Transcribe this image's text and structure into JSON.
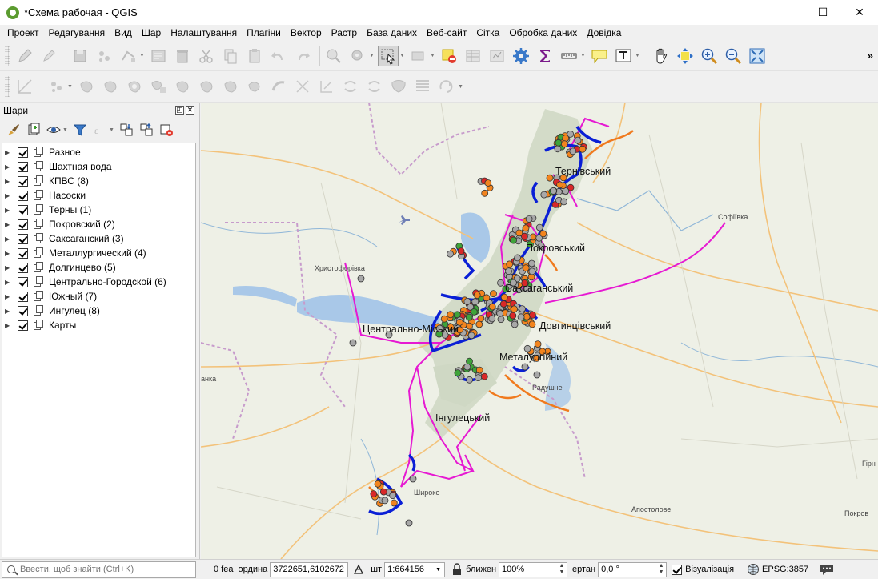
{
  "window": {
    "title": "*Схема рабочая - QGIS",
    "minimize_glyph": "—",
    "maximize_glyph": "☐",
    "close_glyph": "✕"
  },
  "menu": [
    "Проект",
    "Редагування",
    "Вид",
    "Шар",
    "Налаштування",
    "Плагіни",
    "Вектор",
    "Растр",
    "База даних",
    "Веб-сайт",
    "Сітка",
    "Обробка даних",
    "Довідка"
  ],
  "toolbar": {
    "more_glyph": "»"
  },
  "layers_panel": {
    "title": "Шари",
    "layers": [
      "Разное",
      "Шахтная вода",
      "КПВС (8)",
      "Насоски",
      "Терны (1)",
      "Покровский (2)",
      "Саксаганский (3)",
      "Металлургический (4)",
      "Долгинцево (5)",
      "Центрально-Городской (6)",
      "Южный (7)",
      "Ингулец (8)",
      "Карты"
    ]
  },
  "map": {
    "labels": {
      "ternivskyi": "Тернівський",
      "pokrovskyi": "Покровський",
      "saksahanskyi": "Саксаганський",
      "tsentralno": "Центрально-Міський",
      "dovhyntsivskyi": "Довгинцівський",
      "metalurhiinyi": "Металургійний",
      "inhuletskyi": "Інгулецький",
      "sofiivka": "Софіївка",
      "khrystoforivka": "Христофорівка",
      "radushne": "Радушне",
      "shyroke": "Широке",
      "apostolove": "Апостолове",
      "pokrov": "Покров",
      "anka": "анка",
      "hir": "Гірн"
    },
    "colors": {
      "background": "#eef0e6",
      "urban": "#cfd8c4",
      "water": "#a9c8e8",
      "roads": "#f3c27a",
      "boundary": "#c79bcc",
      "network_blue": "#0a1fd6",
      "network_magenta": "#e619d2",
      "network_orange": "#f07a1e",
      "point_orange": "#f2841e",
      "point_grey": "#a8a8a8",
      "point_green": "#3fa33a",
      "point_red": "#d92828"
    }
  },
  "status": {
    "search_placeholder": "Ввести, щоб знайти (Ctrl+K)",
    "features": "0 fea",
    "coord_label": "ордина",
    "coordinate": "3722651,6102672",
    "scale_label": "шт",
    "scale": "1:664156",
    "magnifier_label": "ближен",
    "magnifier": "100%",
    "rotation_label": "ертан",
    "rotation": "0,0 °",
    "render_label": "Візуалізація",
    "crs": "EPSG:3857"
  }
}
